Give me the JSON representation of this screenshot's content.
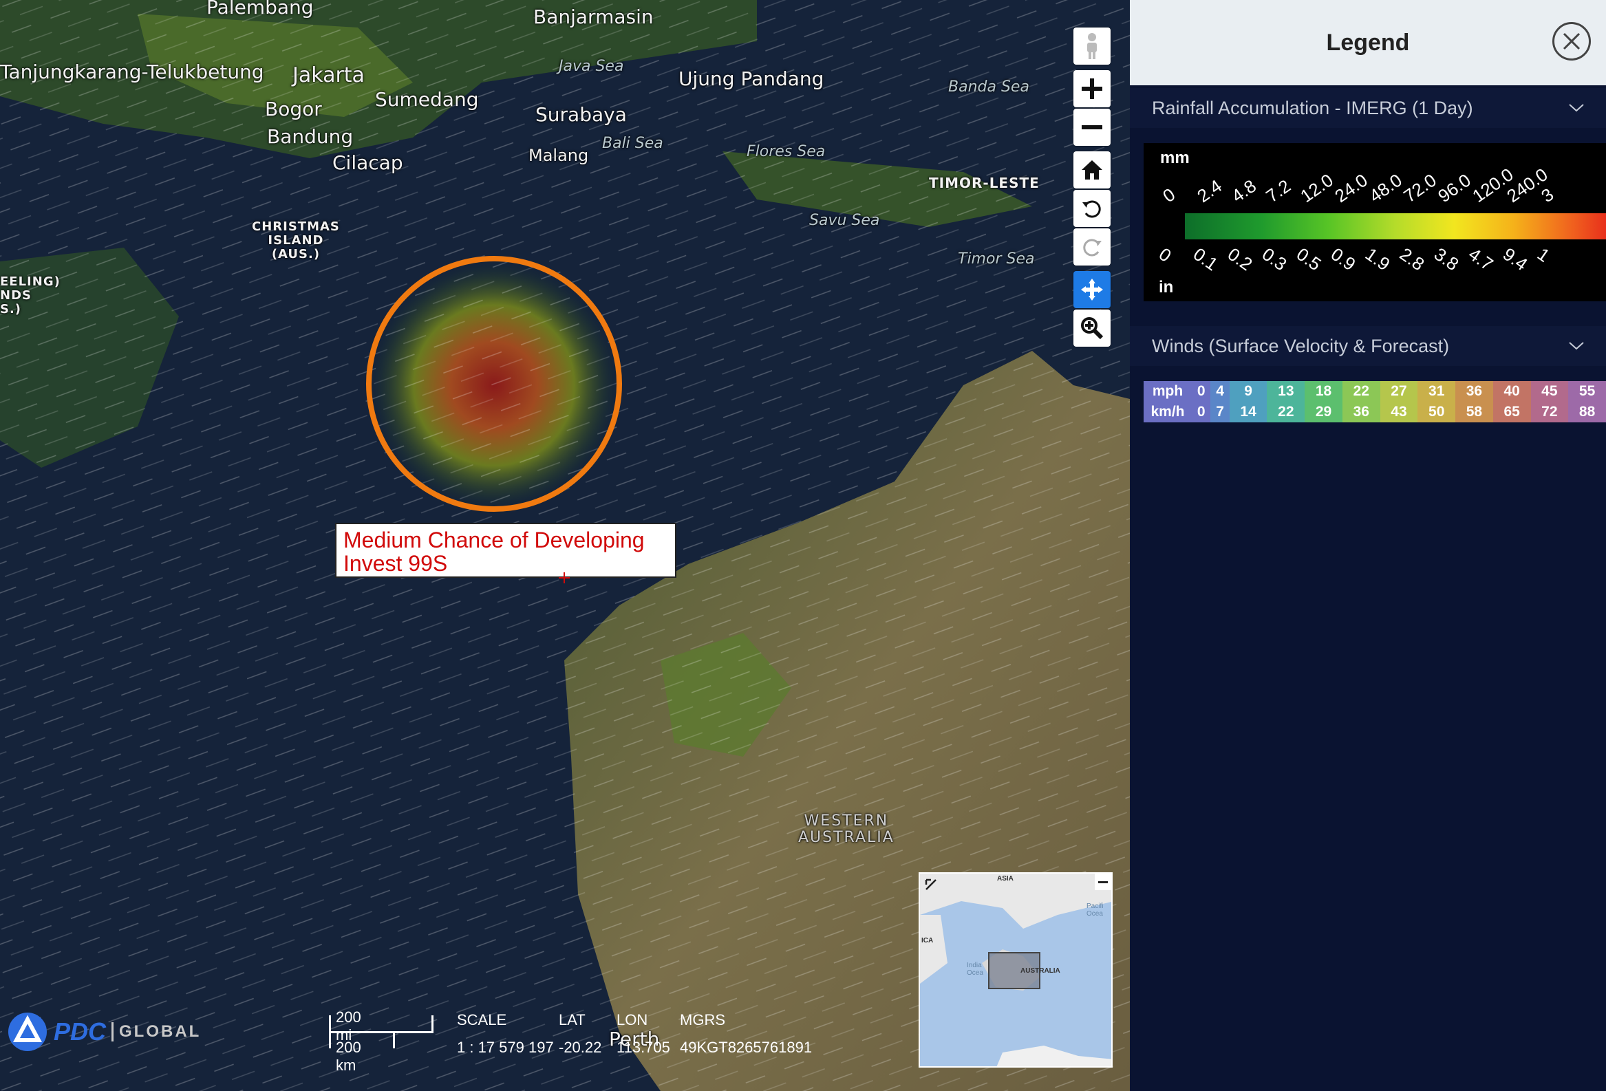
{
  "map": {
    "places": {
      "palembang": "Palembang",
      "banjarmasin": "Banjarmasin",
      "tanjungkarang": "Tanjungkarang-Telukbetung",
      "jakarta": "Jakarta",
      "java_sea": "Java Sea",
      "ujung_pandang": "Ujung Pandang",
      "banda_sea": "Banda Sea",
      "bogor": "Bogor",
      "sumedang": "Sumedang",
      "surabaya": "Surabaya",
      "bandung": "Bandung",
      "bali_sea": "Bali Sea",
      "malang": "Malang",
      "flores_sea": "Flores Sea",
      "cilacap": "Cilacap",
      "timor_leste": "TIMOR-LESTE",
      "savu_sea": "Savu Sea",
      "timor_sea": "Timor Sea",
      "christmas_island": "CHRISTMAS\nISLAND\n(AUS.)",
      "cocos": "EELING)\nNDS\nS.)",
      "western_australia": "WESTERN\nAUSTRALIA",
      "perth": "Perth"
    },
    "callout": {
      "line1": "Medium Chance of Developing",
      "line2": "Invest 99S"
    },
    "scale": {
      "mi": "200 mi",
      "km": "200 km"
    },
    "status": {
      "scale_label": "SCALE",
      "scale_value": "1 : 17 579 197",
      "lat_label": "LAT",
      "lat_value": "-20.22",
      "lon_label": "LON",
      "lon_value": "113.705",
      "mgrs_label": "MGRS",
      "mgrs_value": "49KGT8265761891"
    },
    "logo": {
      "brand": "PDC",
      "suffix": "GLOBAL"
    },
    "minimap": {
      "asia": "ASIA",
      "africa": "ICA",
      "pacific": "Pacifi\nOcea",
      "indian": "India\nOcea",
      "australia": "AUSTRALIA"
    },
    "toolbar_icons": [
      "street-view-icon",
      "zoom-in-icon",
      "zoom-out-icon",
      "home-icon",
      "rotate-left-icon",
      "rotate-right-icon",
      "pan-icon",
      "zoom-box-icon"
    ]
  },
  "legend": {
    "title": "Legend",
    "rainfall": {
      "title": "Rainfall Accumulation - IMERG (1 Day)",
      "unit_top": "mm",
      "unit_bottom": "in",
      "mm_ticks": [
        "0",
        "2.4",
        "4.8",
        "7.2",
        "12.0",
        "24.0",
        "48.0",
        "72.0",
        "96.0",
        "120.0",
        "240.0",
        "3"
      ],
      "in_ticks": [
        "0",
        "0.1",
        "0.2",
        "0.3",
        "0.5",
        "0.9",
        "1.9",
        "2.8",
        "3.8",
        "4.7",
        "9.4",
        "1"
      ]
    },
    "winds": {
      "title": "Winds (Surface Velocity & Forecast)",
      "mph_label": "mph",
      "kmh_label": "km/h",
      "mph": [
        "0",
        "4",
        "9",
        "13",
        "18",
        "22",
        "27",
        "31",
        "36",
        "40",
        "45",
        "55"
      ],
      "kmh": [
        "0",
        "7",
        "14",
        "22",
        "29",
        "36",
        "43",
        "50",
        "58",
        "65",
        "72",
        "88"
      ],
      "colors": [
        "#6b6fc4",
        "#5a86c8",
        "#4fa0bf",
        "#4db59a",
        "#5cbf6e",
        "#8cc756",
        "#b5c64c",
        "#c9b04a",
        "#c9904f",
        "#c27465",
        "#b26a8c",
        "#9d6aa8"
      ]
    },
    "colors": {
      "header_bg": "#e9eef2",
      "panel_bg": "#0a1331"
    }
  }
}
